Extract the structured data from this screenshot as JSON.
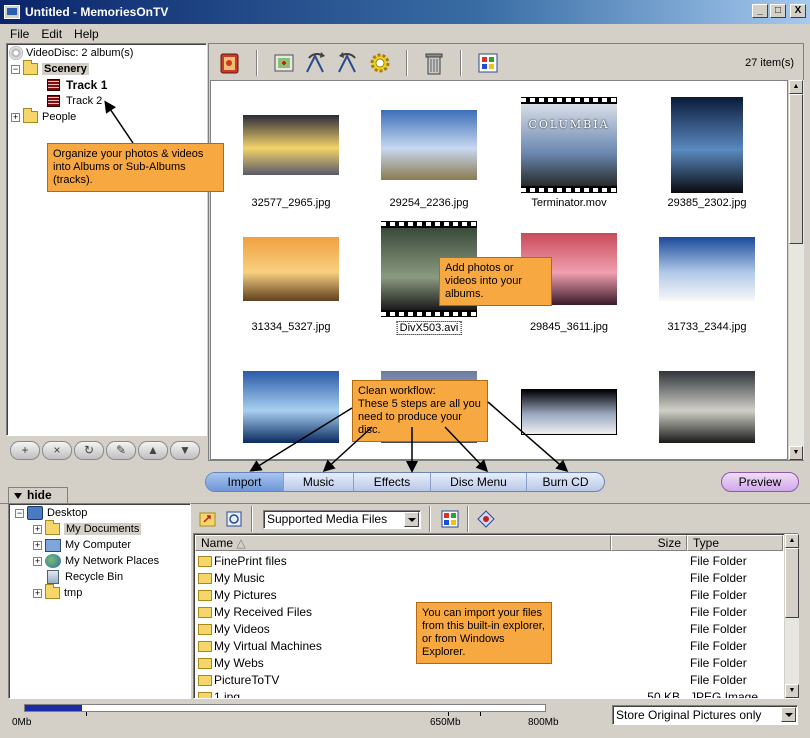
{
  "window": {
    "title": "Untitled - MemoriesOnTV",
    "controls": {
      "minimize": "_",
      "maximize": "□",
      "close": "X"
    }
  },
  "menu": [
    "File",
    "Edit",
    "Help"
  ],
  "album_tree": {
    "root": "VideoDisc: 2 album(s)",
    "albums": [
      {
        "label": "Scenery",
        "expanded": true,
        "tracks": [
          "Track 1",
          "Track 2"
        ]
      },
      {
        "label": "People",
        "expanded": false
      }
    ],
    "action_buttons": [
      "+",
      "×",
      "↻",
      "✎",
      "▲",
      "▼"
    ]
  },
  "toolbar": {
    "icons": [
      "album-icon",
      "add-photo-icon",
      "rotate-left-icon",
      "rotate-right-icon",
      "settings-gear-icon",
      "trash-icon",
      "windows-icon"
    ],
    "item_count": "27 item(s)"
  },
  "thumbnails": [
    {
      "file": "32577_2965.jpg",
      "colors": [
        "#2a2a3a",
        "#f3d36a",
        "#5a5a6a"
      ]
    },
    {
      "file": "29254_2236.jpg",
      "colors": [
        "#3b6fb8",
        "#c8d8f0",
        "#8a7a50"
      ]
    },
    {
      "file": "Terminator.mov",
      "colors": [
        "#d8dde8",
        "#6a88b0",
        "#2a2a2a"
      ],
      "video": true,
      "overlay_text": "COLUMBIA"
    },
    {
      "file": "29385_2302.jpg",
      "colors": [
        "#0a1a3a",
        "#5a8ac0",
        "#0a0a10"
      ]
    },
    {
      "file": "31334_5327.jpg",
      "colors": [
        "#f0a040",
        "#f8d080",
        "#604020"
      ]
    },
    {
      "file": "DivX503.avi",
      "colors": [
        "#3a4a3a",
        "#8a9a80",
        "#1a1a1a"
      ],
      "video": true,
      "selected": true
    },
    {
      "file": "29845_3611.jpg",
      "colors": [
        "#c84a5a",
        "#f0a0b0",
        "#3a1a2a"
      ]
    },
    {
      "file": "31733_2344.jpg",
      "colors": [
        "#1a4a9a",
        "#b0c8e8",
        "#f8f8f8"
      ]
    },
    {
      "file": "",
      "colors": [
        "#2a5aa8",
        "#a8d0f0",
        "#0a2a60"
      ]
    },
    {
      "file": "",
      "colors": [
        "#6a7aa0",
        "#c0c8d8",
        "#404a60"
      ]
    },
    {
      "file": "",
      "colors": [
        "#000000",
        "#9aa8c0",
        "#f0f0f0"
      ]
    },
    {
      "file": "",
      "colors": [
        "#30343a",
        "#d0d0c8",
        "#1a1a1a"
      ]
    }
  ],
  "steps": [
    "Import",
    "Music",
    "Effects",
    "Disc Menu",
    "Burn CD"
  ],
  "preview_button": "Preview",
  "hide_tab": "hide",
  "explorer_tree": {
    "root": "Desktop",
    "items": [
      {
        "label": "My Documents",
        "expandable": true,
        "selected": true
      },
      {
        "label": "My Computer",
        "expandable": true
      },
      {
        "label": "My Network Places",
        "expandable": true
      },
      {
        "label": "Recycle Bin",
        "expandable": false
      },
      {
        "label": "tmp",
        "expandable": true
      }
    ]
  },
  "file_browser": {
    "filter": "Supported Media Files",
    "columns": {
      "name": "Name",
      "size": "Size",
      "type": "Type"
    },
    "rows": [
      {
        "name": "FinePrint files",
        "size": "",
        "type": "File Folder"
      },
      {
        "name": "My Music",
        "size": "",
        "type": "File Folder"
      },
      {
        "name": "My Pictures",
        "size": "",
        "type": "File Folder"
      },
      {
        "name": "My Received Files",
        "size": "",
        "type": "File Folder"
      },
      {
        "name": "My Videos",
        "size": "",
        "type": "File Folder"
      },
      {
        "name": "My Virtual Machines",
        "size": "",
        "type": "File Folder"
      },
      {
        "name": "My Webs",
        "size": "",
        "type": "File Folder"
      },
      {
        "name": "PictureToTV",
        "size": "",
        "type": "File Folder"
      },
      {
        "name": "1.jpg",
        "size": "50 KB",
        "type": "JPEG Image"
      }
    ]
  },
  "capacity": {
    "fill_fraction": 0.11,
    "labels": [
      "0Mb",
      "650Mb",
      "800Mb"
    ]
  },
  "store_option": "Store Original Pictures only",
  "callouts": {
    "organize": "Organize your photos & videos into Albums or Sub-Albums (tracks).",
    "add": "Add photos or videos into your albums.",
    "workflow_title": "Clean workflow:",
    "workflow_body": "These 5 steps are all you need to produce your disc.",
    "import": "You can import your files from this built-in explorer, or from Windows Explorer."
  }
}
